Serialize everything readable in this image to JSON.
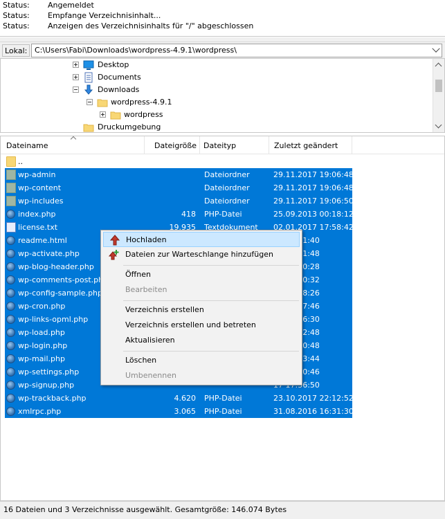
{
  "status_log": [
    {
      "label": "Status:",
      "message": "Angemeldet"
    },
    {
      "label": "Status:",
      "message": "Empfange Verzeichnisinhalt..."
    },
    {
      "label": "Status:",
      "message": "Anzeigen des Verzeichnisinhalts für \"/\" abgeschlossen"
    }
  ],
  "local": {
    "label": "Lokal:",
    "path": "C:\\Users\\Fabi\\Downloads\\wordpress-4.9.1\\wordpress\\"
  },
  "tree": [
    {
      "name": "Desktop",
      "icon": "desktop-icon"
    },
    {
      "name": "Documents",
      "icon": "documents-icon"
    },
    {
      "name": "Downloads",
      "icon": "downloads-icon"
    },
    {
      "name": "wordpress-4.9.1",
      "icon": "folder-icon"
    },
    {
      "name": "wordpress",
      "icon": "folder-icon"
    },
    {
      "name": "Druckumgebung",
      "icon": "folder-icon"
    }
  ],
  "columns": {
    "name": "Dateiname",
    "size": "Dateigröße",
    "type": "Dateityp",
    "modified": "Zuletzt geändert"
  },
  "files": [
    {
      "name": "..",
      "size": "",
      "type": "",
      "modified": "",
      "icon": "folder",
      "selected": false
    },
    {
      "name": "wp-admin",
      "size": "",
      "type": "Dateiordner",
      "modified": "29.11.2017 19:06:48",
      "icon": "folder",
      "selected": true
    },
    {
      "name": "wp-content",
      "size": "",
      "type": "Dateiordner",
      "modified": "29.11.2017 19:06:48",
      "icon": "folder",
      "selected": true
    },
    {
      "name": "wp-includes",
      "size": "",
      "type": "Dateiordner",
      "modified": "29.11.2017 19:06:50",
      "icon": "folder",
      "selected": true
    },
    {
      "name": "index.php",
      "size": "418",
      "type": "PHP-Datei",
      "modified": "25.09.2013 00:18:12",
      "icon": "php",
      "selected": true
    },
    {
      "name": "license.txt",
      "size": "19.935",
      "type": "Textdokument",
      "modified": "02.01.2017 17:58:42",
      "icon": "txt",
      "selected": true
    },
    {
      "name": "readme.html",
      "size": "",
      "type": "",
      "modified": "16 08:01:40",
      "icon": "php",
      "selected": true
    },
    {
      "name": "wp-activate.php",
      "size": "",
      "type": "",
      "modified": "17 12:21:48",
      "icon": "php",
      "selected": true
    },
    {
      "name": "wp-blog-header.php",
      "size": "",
      "type": "",
      "modified": "15 11:20:28",
      "icon": "php",
      "selected": true
    },
    {
      "name": "wp-comments-post.php",
      "size": "",
      "type": "",
      "modified": "16 12:00:32",
      "icon": "php",
      "selected": true
    },
    {
      "name": "wp-config-sample.php",
      "size": "",
      "type": "",
      "modified": "15 09:58:26",
      "icon": "php",
      "selected": true
    },
    {
      "name": "wp-cron.php",
      "size": "",
      "type": "",
      "modified": "17 04:37:46",
      "icon": "php",
      "selected": true
    },
    {
      "name": "wp-links-opml.php",
      "size": "",
      "type": "",
      "modified": "16 02:46:30",
      "icon": "php",
      "selected": true
    },
    {
      "name": "wp-load.php",
      "size": "",
      "type": "",
      "modified": "17 11:52:48",
      "icon": "php",
      "selected": true
    },
    {
      "name": "wp-login.php",
      "size": "",
      "type": "",
      "modified": "17 02:10:48",
      "icon": "php",
      "selected": true
    },
    {
      "name": "wp-mail.php",
      "size": "",
      "type": "",
      "modified": "17 05:13:44",
      "icon": "php",
      "selected": true
    },
    {
      "name": "wp-settings.php",
      "size": "",
      "type": "",
      "modified": "17 00:20:46",
      "icon": "php",
      "selected": true
    },
    {
      "name": "wp-signup.php",
      "size": "",
      "type": "",
      "modified": "17 17:36:50",
      "icon": "php",
      "selected": true
    },
    {
      "name": "wp-trackback.php",
      "size": "4.620",
      "type": "PHP-Datei",
      "modified": "23.10.2017 22:12:52",
      "icon": "php",
      "selected": true
    },
    {
      "name": "xmlrpc.php",
      "size": "3.065",
      "type": "PHP-Datei",
      "modified": "31.08.2016 16:31:30",
      "icon": "php",
      "selected": true
    }
  ],
  "context_menu": {
    "upload": "Hochladen",
    "queue": "Dateien zur Warteschlange hinzufügen",
    "open": "Öffnen",
    "edit": "Bearbeiten",
    "mkdir": "Verzeichnis erstellen",
    "mkdir_enter": "Verzeichnis erstellen und betreten",
    "refresh": "Aktualisieren",
    "delete": "Löschen",
    "rename": "Umbenennen"
  },
  "statusbar": {
    "text": "16 Dateien und 3 Verzeichnisse ausgewählt. Gesamtgröße: 146.074 Bytes"
  },
  "colors": {
    "selection": "#0078d7",
    "menu_highlight": "#cce8ff",
    "upload_arrow": "#c0392b",
    "queue_plus": "#2e9b3a"
  }
}
